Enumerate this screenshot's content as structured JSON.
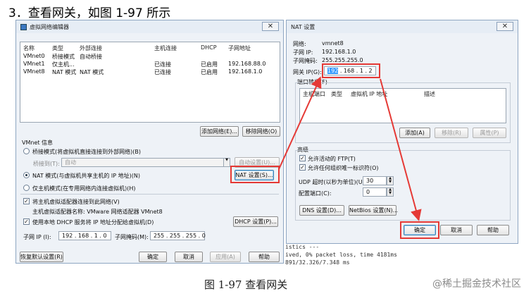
{
  "heading": "3．查看网关，如图 1-97 所示",
  "caption": "图 1-97  查看网关",
  "watermark": "@稀土掘金技术社区",
  "left_window": {
    "title": "虚拟网络编辑器",
    "close_glyph": "✕",
    "table_headers": [
      "名称",
      "类型",
      "外部连接",
      "主机连接",
      "DHCP",
      "子网地址"
    ],
    "rows": [
      [
        "VMnet0",
        "桥接模式",
        "自动桥接",
        "",
        "",
        ""
      ],
      [
        "VMnet1",
        "仅主机...",
        "",
        "已连接",
        "已启用",
        "192.168.88.0"
      ],
      [
        "VMnet8",
        "NAT 模式",
        "NAT 模式",
        "已连接",
        "已启用",
        "192.168.1.0"
      ]
    ],
    "add_network_button": "添加网络(E)...",
    "remove_network_button": "移除网络(O)",
    "vmnet_info_label": "VMnet 信息",
    "bridge_radio": "桥接模式(将虚拟机直接连接到外部网络)(B)",
    "bridge_to_label": "桥接到(T):",
    "bridge_to_value": "自动",
    "auto_settings_button": "自动设置(U)...",
    "nat_radio": "NAT 模式(与虚拟机共享主机的 IP 地址)(N)",
    "nat_settings_button": "NAT 设置(S)...",
    "hostonly_radio": "仅主机模式(在专用网络内连接虚拟机)(H)",
    "connect_adapter_check": "将主机虚拟适配器连接到此网络(V)",
    "adapter_name_label": "主机虚拟适配器名称: VMware 网络适配器 VMnet8",
    "dhcp_check": "使用本地 DHCP 服务将 IP 地址分配给虚拟机(D)",
    "dhcp_settings_button": "DHCP 设置(P)...",
    "subnet_ip_label": "子网 IP (I):",
    "subnet_ip_value": "192 . 168 . 1 . 0",
    "subnet_mask_label": "子网掩码(M):",
    "subnet_mask_value": "255 . 255 . 255 . 0",
    "restore_defaults_button": "恢复默认设置(R)",
    "ok_button": "确定",
    "cancel_button": "取消",
    "apply_button": "应用(A)",
    "help_button": "帮助"
  },
  "right_window": {
    "title": "NAT 设置",
    "close_glyph": "✕",
    "network_label": "网络:",
    "network_value": "vmnet8",
    "subnet_ip_label": "子网 IP:",
    "subnet_ip_value": "192.168.1.0",
    "subnet_mask_label": "子网掩码:",
    "subnet_mask_value": "255.255.255.0",
    "gateway_label": "网关 IP(G):",
    "gateway_first_octet": "192",
    "gateway_rest": ". 168 .  1  .  2",
    "port_forward_label": "端口转发(F)",
    "port_headers": [
      "主机端口",
      "类型",
      "虚拟机 IP 地址",
      "描述"
    ],
    "add_button": "添加(A)",
    "remove_button": "移除(R)",
    "properties_button": "属性(P)",
    "advanced_label": "高级",
    "ftp_check": "允许活动的 FTP(T)",
    "any_oui_check": "允许任何组织唯一标识符(O)",
    "udp_timeout_label": "UDP 超时(以秒为单位)(U):",
    "udp_timeout_value": "30",
    "config_port_label": "配置端口(C):",
    "config_port_value": "0",
    "dns_button": "DNS 设置(D)...",
    "netbios_button": "NetBios 设置(N)...",
    "ok_button": "确定",
    "cancel_button": "取消",
    "help_button": "帮助"
  },
  "terminal_lines": [
    "istics ---",
    "ived, 0% packet loss, time 4181ms",
    "  891/32.326/7.348 ms"
  ],
  "colors": {
    "highlight_red": "#e53935",
    "selected_blue": "#3399ff"
  }
}
